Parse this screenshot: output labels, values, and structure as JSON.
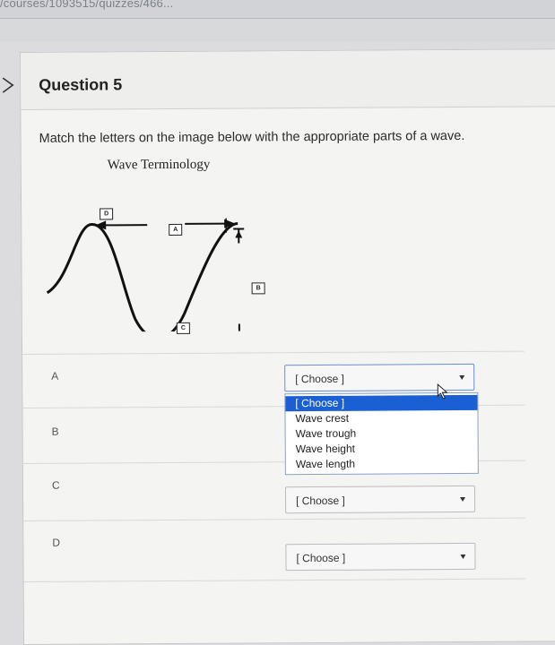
{
  "browser": {
    "url_fragment": "/courses/1093515/quizzes/466..."
  },
  "question": {
    "title": "Question 5",
    "prompt": "Match the letters on the image below with the appropriate parts of a wave.",
    "figure": {
      "title": "Wave Terminology",
      "labels": [
        "D",
        "A",
        "B",
        "C"
      ]
    }
  },
  "answers": [
    {
      "letter": "A",
      "selected": "[ Choose ]",
      "open": true
    },
    {
      "letter": "B",
      "selected": "",
      "open": false
    },
    {
      "letter": "C",
      "selected": "[ Choose ]",
      "open": false
    },
    {
      "letter": "D",
      "selected": "[ Choose ]",
      "open": false
    }
  ],
  "dropdown_options": [
    "[ Choose ]",
    "Wave crest",
    "Wave trough",
    "Wave height",
    "Wave length"
  ],
  "highlighted_option": "[ Choose ]",
  "colors": {
    "highlight": "#1a5fd4",
    "card_bg": "#f4f4f3"
  }
}
